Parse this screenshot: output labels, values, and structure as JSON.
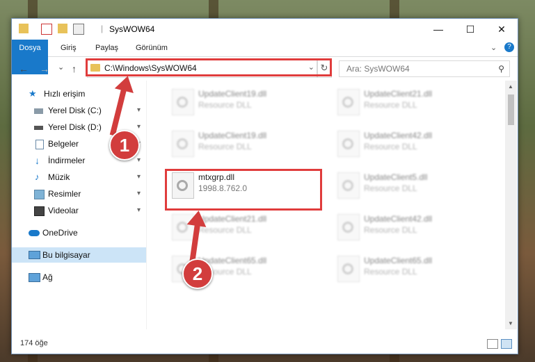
{
  "window": {
    "title": "SysWOW64",
    "controls": {
      "minimize": "—",
      "maximize": "☐",
      "close": "✕"
    }
  },
  "ribbon": {
    "tabs": [
      "Dosya",
      "Giriş",
      "Paylaş",
      "Görünüm"
    ],
    "accent": "#1979ca",
    "help": "?"
  },
  "nav": {
    "back": "←",
    "forward": "→",
    "recent": "⌄",
    "up": "↑",
    "address": "C:\\Windows\\SysWOW64",
    "refresh": "↻",
    "search_placeholder": "Ara: SysWOW64",
    "search_icon": "⚲"
  },
  "sidebar": {
    "items": [
      {
        "label": "Hızlı erişim",
        "icon": "star-icon",
        "pinned": false
      },
      {
        "label": "Yerel Disk (C:)",
        "icon": "drive-icon",
        "pinned": true
      },
      {
        "label": "Yerel Disk (D:)",
        "icon": "drive-icon",
        "pinned": true
      },
      {
        "label": "Belgeler",
        "icon": "documents-icon",
        "pinned": true
      },
      {
        "label": "İndirmeler",
        "icon": "download-icon",
        "pinned": true
      },
      {
        "label": "Müzik",
        "icon": "music-icon",
        "pinned": true
      },
      {
        "label": "Resimler",
        "icon": "pictures-icon",
        "pinned": true
      },
      {
        "label": "Videolar",
        "icon": "videos-icon",
        "pinned": true
      },
      {
        "label": "OneDrive",
        "icon": "cloud-icon",
        "pinned": false
      },
      {
        "label": "Bu bilgisayar",
        "icon": "computer-icon",
        "pinned": false
      },
      {
        "label": "Ağ",
        "icon": "network-icon",
        "pinned": false
      }
    ],
    "pin_glyph": "📌"
  },
  "files": [
    {
      "name": "UpdateClient19.dll",
      "sub": "Resource DLL"
    },
    {
      "name": "UpdateClient21.dll",
      "sub": "Resource DLL"
    },
    {
      "name": "UpdateClient19.dll",
      "sub": "Resource DLL"
    },
    {
      "name": "UpdateClient42.dll",
      "sub": "Resource DLL"
    },
    {
      "name": "mtxgrp.dll",
      "sub": "1998.8.762.0"
    },
    {
      "name": "UpdateClient5.dll",
      "sub": "Resource DLL"
    },
    {
      "name": "UpdateClient21.dll",
      "sub": "Resource DLL"
    },
    {
      "name": "UpdateClient42.dll",
      "sub": "Resource DLL"
    },
    {
      "name": "UpdateClient65.dll",
      "sub": "Resource DLL"
    },
    {
      "name": "UpdateClient65.dll",
      "sub": "Resource DLL"
    }
  ],
  "status": {
    "count": "174 öğe"
  },
  "annotations": {
    "marker1": "1",
    "marker2": "2",
    "color": "#e03c3c"
  }
}
